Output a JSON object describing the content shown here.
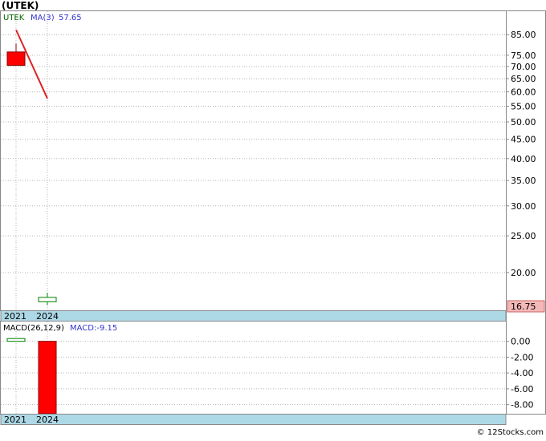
{
  "title": "(UTEK)",
  "footer": "© 12Stocks.com",
  "price_panel": {
    "ticker_label": "UTEK",
    "ma_label": "MA(3)",
    "ma_value": "57.65",
    "last_price_badge": "16.75",
    "x_ticks": [
      "2021",
      "2024"
    ]
  },
  "macd_panel": {
    "label": "MACD(26,12,9)",
    "value_label": "MACD:-9.15",
    "x_ticks": [
      "2021",
      "2024"
    ]
  },
  "colors": {
    "bearish_candle": "#ff0000",
    "bullish_candle": "#ffffff",
    "bullish_border": "#008000",
    "ma_line": "#dd2222",
    "axis_band": "#add8e6",
    "last_price_badge": "#f4b8b8",
    "label_blue": "#3333cc",
    "label_green": "#006600"
  },
  "chart_data": [
    {
      "type": "candlestick",
      "scale": "log",
      "x": [
        "2021",
        "2024"
      ],
      "candles": [
        {
          "x": "2021",
          "open": 76.5,
          "close": 70.5,
          "high": 80.5,
          "low": 70.5
        },
        {
          "x": "2024",
          "open": 16.75,
          "close": 17.2,
          "high": 17.7,
          "low": 16.4
        }
      ],
      "series": [
        {
          "name": "MA(3)",
          "x": [
            "2021",
            "2024"
          ],
          "values": [
            87.5,
            57.65
          ]
        }
      ],
      "y_ticks": [
        85.0,
        75.0,
        70.0,
        65.0,
        60.0,
        55.0,
        50.0,
        45.0,
        40.0,
        35.0,
        30.0,
        25.0,
        20.0
      ],
      "y_tick_labels": [
        "85.00",
        "75.00",
        "70.00",
        "65.00",
        "60.00",
        "55.00",
        "50.00",
        "45.00",
        "40.00",
        "35.00",
        "30.00",
        "25.00",
        "20.00"
      ],
      "ylim": [
        15.9,
        98
      ],
      "last_value": 16.75,
      "grid": true
    },
    {
      "type": "bar",
      "x": [
        "2021",
        "2024"
      ],
      "series": [
        {
          "name": "MACD",
          "values": [
            0.35,
            -9.15
          ]
        }
      ],
      "y_ticks": [
        0,
        -2,
        -4,
        -6,
        -8
      ],
      "y_tick_labels": [
        "0.00",
        "-2.00",
        "-4.00",
        "-6.00",
        "-8.00"
      ],
      "ylim": [
        -9.15,
        2.5
      ],
      "grid": true
    }
  ]
}
